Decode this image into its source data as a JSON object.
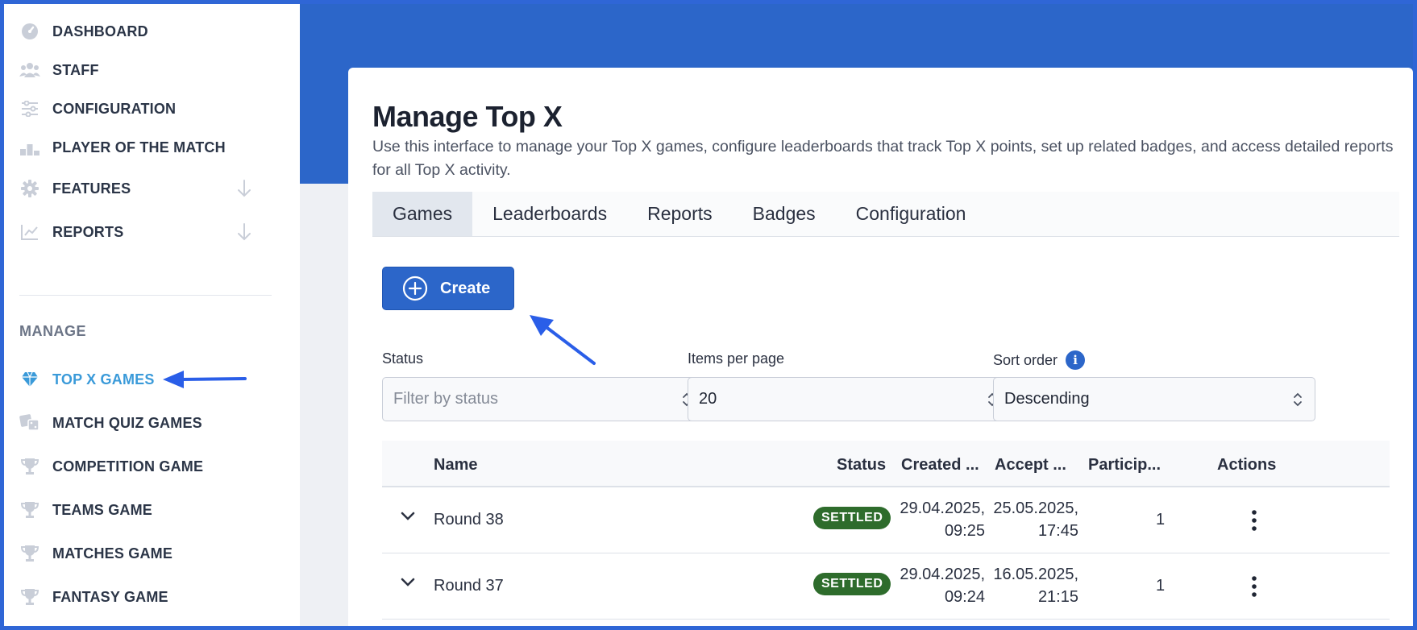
{
  "sidebar": {
    "items": [
      {
        "label": "DASHBOARD",
        "icon": "dashboard-gauge-icon"
      },
      {
        "label": "STAFF",
        "icon": "users-icon"
      },
      {
        "label": "CONFIGURATION",
        "icon": "sliders-icon"
      },
      {
        "label": "PLAYER OF THE MATCH",
        "icon": "podium-icon"
      },
      {
        "label": "FEATURES",
        "icon": "gear-icon"
      },
      {
        "label": "REPORTS",
        "icon": "line-chart-icon"
      }
    ],
    "section_label": "MANAGE",
    "manage_items": [
      {
        "label": "TOP X GAMES",
        "icon": "diamond-icon"
      },
      {
        "label": "MATCH QUIZ GAMES",
        "icon": "dice-icon"
      },
      {
        "label": "COMPETITION GAME",
        "icon": "trophy-icon"
      },
      {
        "label": "TEAMS GAME",
        "icon": "trophy-icon"
      },
      {
        "label": "MATCHES GAME",
        "icon": "trophy-icon"
      },
      {
        "label": "FANTASY GAME",
        "icon": "trophy-icon"
      }
    ]
  },
  "main": {
    "title": "Manage Top X",
    "description": "Use this interface to manage your Top X games, configure leaderboards that track Top X points, set up related badges, and access detailed reports for all Top X activity.",
    "tabs": [
      "Games",
      "Leaderboards",
      "Reports",
      "Badges",
      "Configuration"
    ],
    "create_label": "Create",
    "filters": {
      "status": {
        "label": "Status",
        "placeholder": "Filter by status"
      },
      "items_per_page": {
        "label": "Items per page",
        "value": "20"
      },
      "sort_order": {
        "label": "Sort order",
        "value": "Descending",
        "info": "i"
      }
    },
    "table": {
      "headers": [
        "Name",
        "Status",
        "Created ...",
        "Accept ...",
        "Particip...",
        "Actions"
      ],
      "rows": [
        {
          "name": "Round 38",
          "status": "SETTLED",
          "created_date": "29.04.2025,",
          "created_time": "09:25",
          "accept_date": "25.05.2025,",
          "accept_time": "17:45",
          "participants": "1"
        },
        {
          "name": "Round 37",
          "status": "SETTLED",
          "created_date": "29.04.2025,",
          "created_time": "09:24",
          "accept_date": "16.05.2025,",
          "accept_time": "21:15",
          "participants": "1"
        }
      ]
    }
  },
  "colors": {
    "brand_blue": "#2c66c9",
    "active_nav": "#3a9ad9",
    "settled_badge": "#2e6c2c",
    "annotation_arrow": "#2a5ee8"
  }
}
